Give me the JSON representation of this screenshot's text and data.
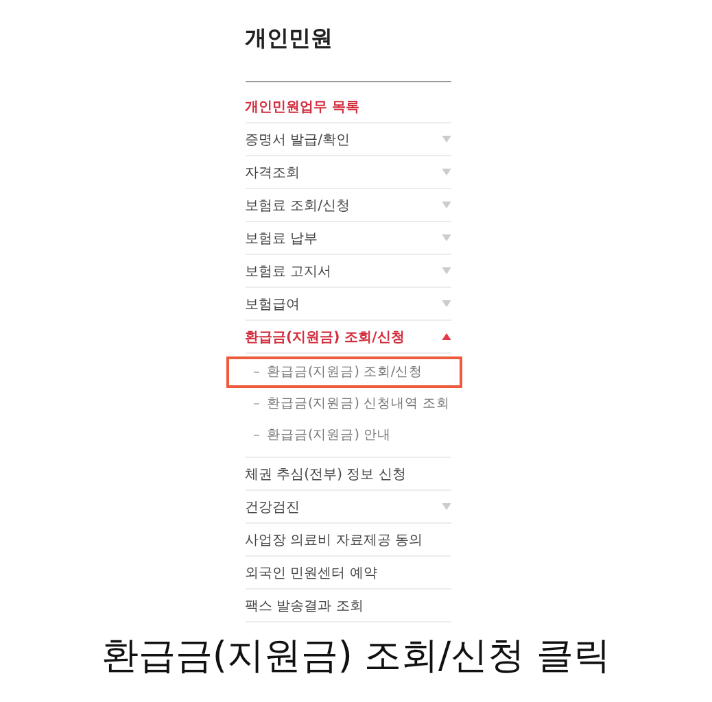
{
  "title": "개인민원",
  "menu": {
    "heading": "개인민원업무 목록",
    "items": [
      {
        "label": "증명서 발급/확인",
        "kind": "folder",
        "expanded": false
      },
      {
        "label": "자격조회",
        "kind": "folder",
        "expanded": false
      },
      {
        "label": "보험료 조회/신청",
        "kind": "folder",
        "expanded": false
      },
      {
        "label": "보험료 납부",
        "kind": "folder",
        "expanded": false
      },
      {
        "label": "보험료 고지서",
        "kind": "folder",
        "expanded": false
      },
      {
        "label": "보험급여",
        "kind": "folder",
        "expanded": false
      },
      {
        "label": "환급금(지원금) 조회/신청",
        "kind": "folder",
        "expanded": true,
        "children": [
          {
            "label": "환급금(지원금) 조회/신청",
            "highlighted": true
          },
          {
            "label": "환급금(지원금) 신청내역 조회",
            "highlighted": false
          },
          {
            "label": "환급금(지원금) 안내",
            "highlighted": false
          }
        ]
      },
      {
        "label": "체권 추심(전부) 정보 신청",
        "kind": "link"
      },
      {
        "label": "건강검진",
        "kind": "folder",
        "expanded": false
      },
      {
        "label": "사업장 의료비 자료제공 동의",
        "kind": "link"
      },
      {
        "label": "외국인 민원센터 예약",
        "kind": "link"
      },
      {
        "label": "팩스 발송결과 조회",
        "kind": "link"
      }
    ]
  },
  "caption": "환급금(지원금) 조회/신청 클릭"
}
